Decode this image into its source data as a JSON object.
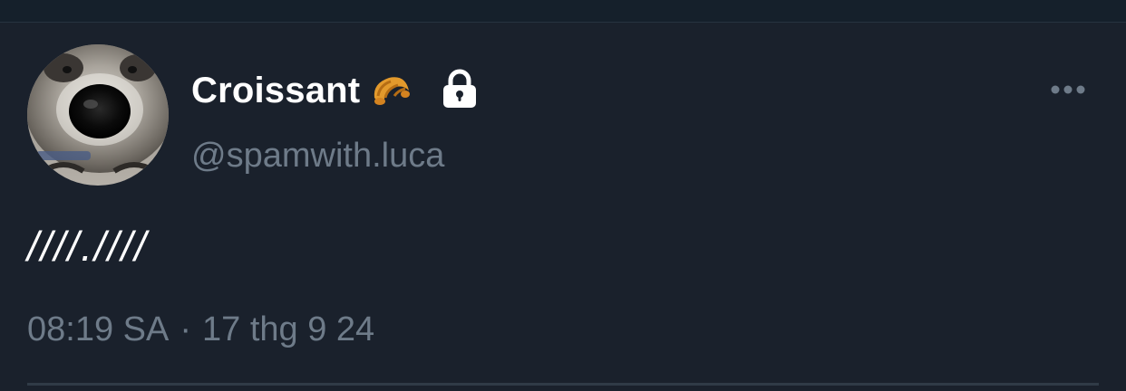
{
  "tweet": {
    "author": {
      "display_name": "Croissant",
      "name_emoji": "croissant-emoji",
      "protected_icon": "lock-icon",
      "handle": "@spamwith.luca",
      "avatar": "raccoon-closeup-avatar"
    },
    "more_icon": "more-horizontal-icon",
    "text": "////.////",
    "time": "08:19 SA",
    "separator": "·",
    "date": "17 thg 9 24"
  },
  "colors": {
    "background": "#1a212c",
    "primary_text": "#ffffff",
    "secondary_text": "#6e7b89",
    "divider": "#303b47"
  }
}
